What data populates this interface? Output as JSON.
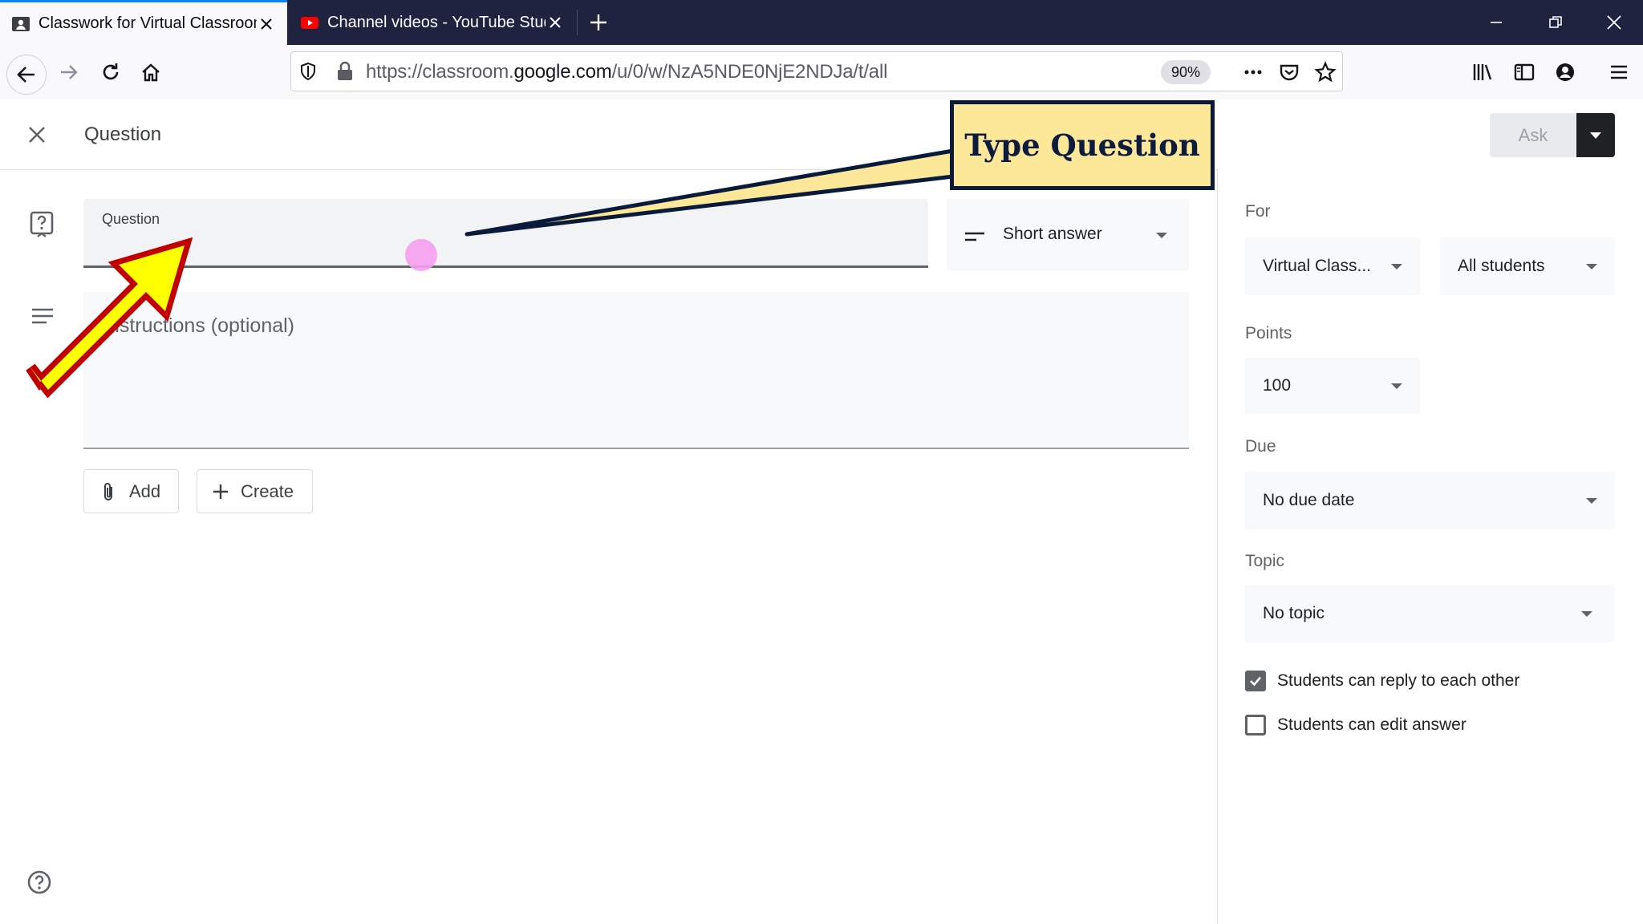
{
  "browser": {
    "tabs": [
      {
        "title": "Classwork for Virtual Classroom",
        "active": true,
        "icon": "classroom-icon"
      },
      {
        "title": "Channel videos - YouTube Studio",
        "active": false,
        "icon": "youtube-icon"
      }
    ],
    "url_prefix": "https://classroom.",
    "url_domain": "google.com",
    "url_path": "/u/0/w/NzA5NDE0NjE2NDJa/t/all",
    "zoom": "90%"
  },
  "header": {
    "title": "Question",
    "ask_label": "Ask"
  },
  "form": {
    "question_label": "Question",
    "type_label": "Short answer",
    "instructions_placeholder": "Instructions (optional)",
    "add_label": "Add",
    "create_label": "Create"
  },
  "side": {
    "for_label": "For",
    "class_value": "Virtual Class...",
    "students_value": "All students",
    "points_label": "Points",
    "points_value": "100",
    "due_label": "Due",
    "due_value": "No due date",
    "topic_label": "Topic",
    "topic_value": "No topic",
    "reply_label": "Students can reply to each other",
    "reply_checked": true,
    "edit_label": "Students can edit answer",
    "edit_checked": false
  },
  "annotation": {
    "callout_text": "Type Question"
  },
  "colors": {
    "arrow_fill": "#ffff00",
    "arrow_outline": "#c00000",
    "callout_fill": "#fde798",
    "callout_border": "#0a1a3a",
    "tabstrip": "#202340"
  }
}
